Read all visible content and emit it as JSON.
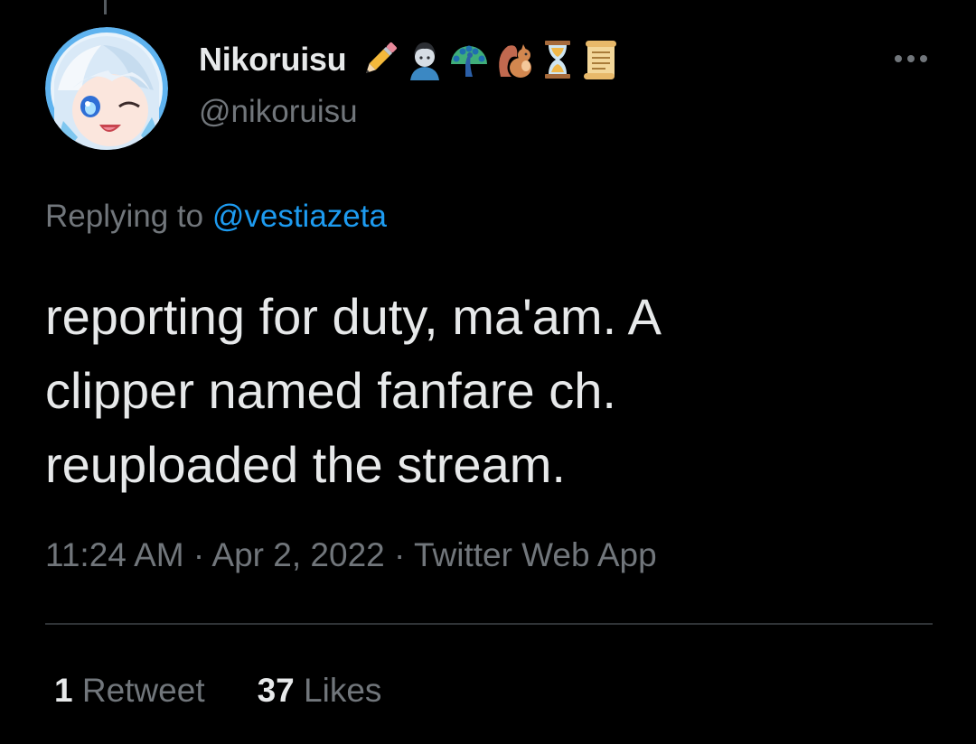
{
  "tweet": {
    "display_name": "Nikoruisu",
    "handle": "@nikoruisu",
    "name_emoji_icons": [
      "pencil-icon",
      "person-icon",
      "peacock-icon",
      "squirrel-icon",
      "hourglass-icon",
      "scroll-icon"
    ],
    "replying_prefix": "Replying to ",
    "replying_to": "@vestiazeta",
    "text_lines": [
      "reporting for duty, ma'am. A",
      "clipper named fanfare ch.",
      "reuploaded the stream."
    ],
    "timestamp": "11:24 AM · Apr 2, 2022 · Twitter Web App",
    "stats": {
      "retweets_count": "1",
      "retweets_label": "Retweet",
      "likes_count": "37",
      "likes_label": "Likes"
    }
  },
  "colors": {
    "background": "#000000",
    "primary_text": "#e7e9ea",
    "secondary_text": "#71767b",
    "link": "#1d9bf0",
    "divider": "#2f3336"
  }
}
